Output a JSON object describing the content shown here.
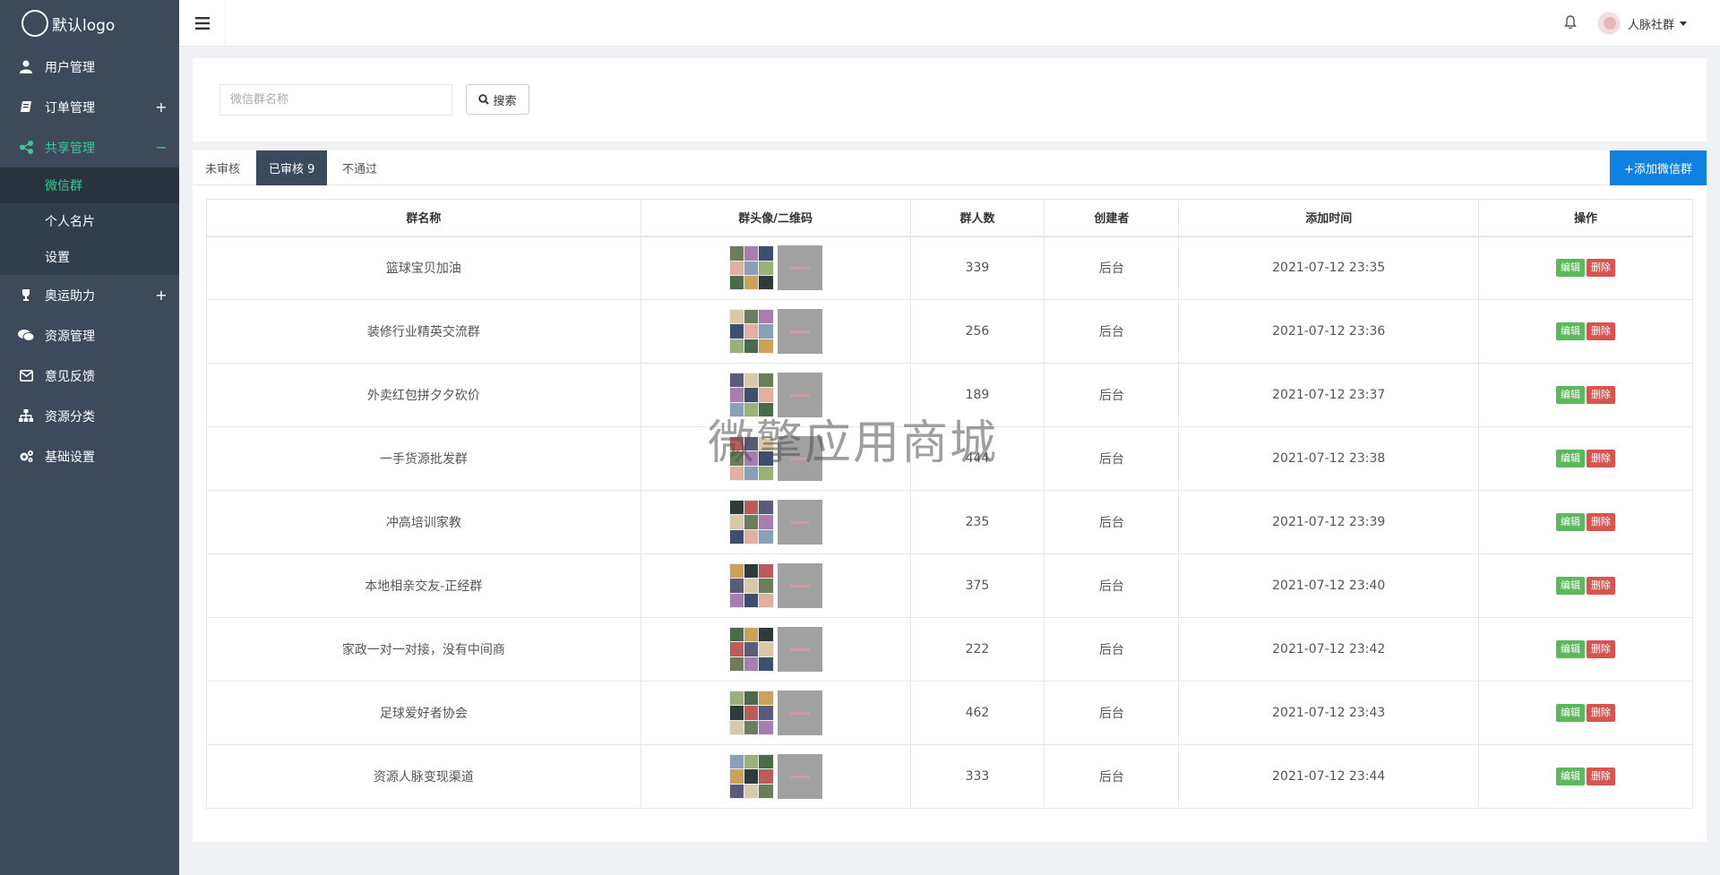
{
  "logo": {
    "text": "默认logo"
  },
  "sidebar": {
    "items": [
      {
        "label": "用户管理",
        "icon": "user-icon",
        "toggle": ""
      },
      {
        "label": "订单管理",
        "icon": "book-icon",
        "toggle": "+"
      },
      {
        "label": "共享管理",
        "icon": "share-icon",
        "toggle": "−",
        "active": true,
        "children": [
          {
            "label": "微信群",
            "selected": true
          },
          {
            "label": "个人名片"
          },
          {
            "label": "设置"
          }
        ]
      },
      {
        "label": "奥运助力",
        "icon": "trophy-icon",
        "toggle": "+"
      },
      {
        "label": "资源管理",
        "icon": "chat-icon",
        "toggle": ""
      },
      {
        "label": "意见反馈",
        "icon": "mail-icon",
        "toggle": ""
      },
      {
        "label": "资源分类",
        "icon": "sitemap-icon",
        "toggle": ""
      },
      {
        "label": "基础设置",
        "icon": "gears-icon",
        "toggle": ""
      }
    ]
  },
  "topbar": {
    "username": "人脉社群"
  },
  "search": {
    "placeholder": "微信群名称",
    "button_label": "搜索"
  },
  "tabs": [
    {
      "label": "未审核"
    },
    {
      "label": "已审核 9",
      "active": true
    },
    {
      "label": "不通过"
    }
  ],
  "add_button": "+添加微信群",
  "table": {
    "headers": [
      "群名称",
      "群头像/二维码",
      "群人数",
      "创建者",
      "添加时间",
      "操作"
    ],
    "rows": [
      {
        "name": "篮球宝贝加油",
        "count": "339",
        "creator": "后台",
        "time": "2021-07-12 23:35"
      },
      {
        "name": "装修行业精英交流群",
        "count": "256",
        "creator": "后台",
        "time": "2021-07-12 23:36"
      },
      {
        "name": "外卖红包拼夕夕砍价",
        "count": "189",
        "creator": "后台",
        "time": "2021-07-12 23:37"
      },
      {
        "name": "一手货源批发群",
        "count": "444",
        "creator": "后台",
        "time": "2021-07-12 23:38"
      },
      {
        "name": "冲高培训家教",
        "count": "235",
        "creator": "后台",
        "time": "2021-07-12 23:39"
      },
      {
        "name": "本地相亲交友-正经群",
        "count": "375",
        "creator": "后台",
        "time": "2021-07-12 23:40"
      },
      {
        "name": "家政一对一对接，没有中间商",
        "count": "222",
        "creator": "后台",
        "time": "2021-07-12 23:42"
      },
      {
        "name": "足球爱好者协会",
        "count": "462",
        "creator": "后台",
        "time": "2021-07-12 23:43"
      },
      {
        "name": "资源人脉变现渠道",
        "count": "333",
        "creator": "后台",
        "time": "2021-07-12 23:44"
      }
    ],
    "edit_label": "编辑",
    "delete_label": "删除"
  },
  "watermark": "微擎应用商城",
  "colors": {
    "sidebar_bg": "#3e4a5b",
    "accent_green": "#42c595",
    "tab_active": "#3c4a5e",
    "primary_blue": "#1081e0",
    "edit_green": "#5cb85c",
    "delete_red": "#d9534f"
  }
}
